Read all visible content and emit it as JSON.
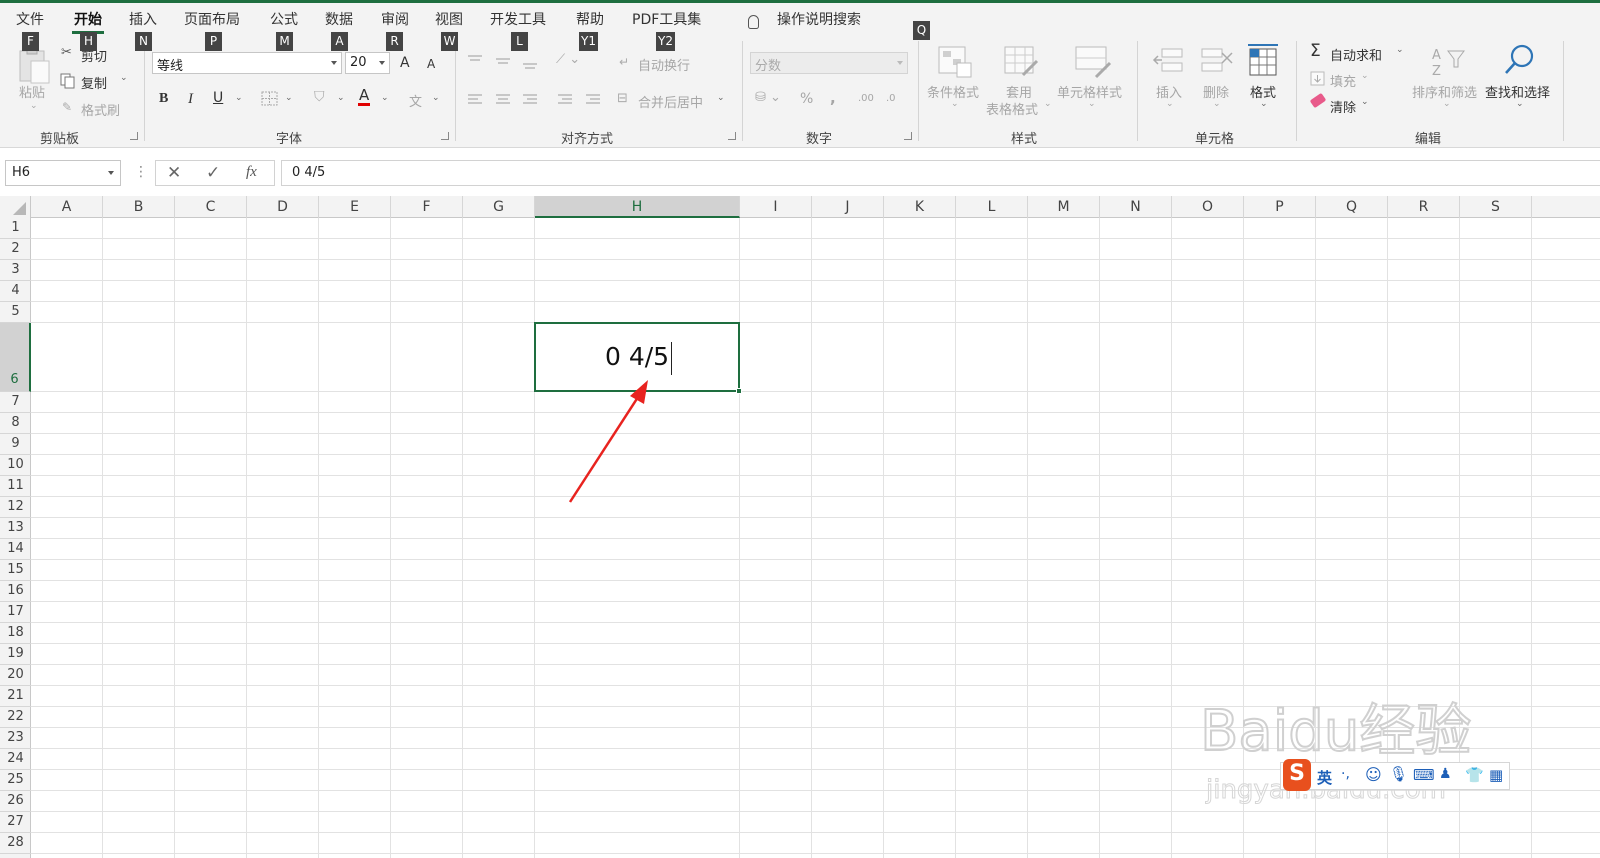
{
  "ribbon_tabs": [
    {
      "label": "文件",
      "key": "F",
      "active": false
    },
    {
      "label": "开始",
      "key": "H",
      "active": true
    },
    {
      "label": "插入",
      "key": "N",
      "active": false
    },
    {
      "label": "页面布局",
      "key": "P",
      "active": false
    },
    {
      "label": "公式",
      "key": "M",
      "active": false
    },
    {
      "label": "数据",
      "key": "A",
      "active": false
    },
    {
      "label": "审阅",
      "key": "R",
      "active": false
    },
    {
      "label": "视图",
      "key": "W",
      "active": false
    },
    {
      "label": "开发工具",
      "key": "L",
      "active": false
    },
    {
      "label": "帮助",
      "key": "Y1",
      "active": false
    },
    {
      "label": "PDF工具集",
      "key": "Y2",
      "active": false
    }
  ],
  "tell_me": {
    "label": "操作说明搜索",
    "key": "Q"
  },
  "clipboard": {
    "paste": "粘贴",
    "cut": "剪切",
    "copy": "复制",
    "format_painter": "格式刷",
    "group": "剪贴板"
  },
  "font": {
    "name": "等线",
    "size": "20",
    "grow": "A",
    "shrink": "A",
    "bold": "B",
    "italic": "I",
    "underline": "U",
    "font_color": "A",
    "phonetic": "文",
    "group": "字体"
  },
  "alignment": {
    "wrap_text": "自动换行",
    "merge_center": "合并后居中",
    "group": "对齐方式"
  },
  "number": {
    "format": "分数",
    "percent": "%",
    "comma": ",",
    "inc_decimal": ".00",
    "dec_decimal": ".0",
    "group": "数字"
  },
  "styles": {
    "conditional": "条件格式",
    "format_table_1": "套用",
    "format_table_2": "表格格式",
    "cell_styles": "单元格样式",
    "group": "样式"
  },
  "cells_group": {
    "insert": "插入",
    "delete": "删除",
    "format": "格式",
    "group": "单元格"
  },
  "editing": {
    "autosum": "自动求和",
    "fill": "填充",
    "clear": "清除",
    "sort_filter": "排序和筛选",
    "find_select": "查找和选择",
    "group": "编辑"
  },
  "formula_bar": {
    "name_box": "H6",
    "content": "0 4/5"
  },
  "columns": [
    "A",
    "B",
    "C",
    "D",
    "E",
    "F",
    "G",
    "H",
    "I",
    "J",
    "K",
    "L",
    "M",
    "N",
    "O",
    "P",
    "Q",
    "R",
    "S"
  ],
  "rows": [
    "1",
    "2",
    "3",
    "4",
    "5",
    "6",
    "7",
    "8",
    "9",
    "10",
    "11",
    "12",
    "13",
    "14",
    "15",
    "16",
    "17",
    "18",
    "19",
    "20",
    "21",
    "22",
    "23",
    "24",
    "25",
    "26",
    "27",
    "28"
  ],
  "active_cell": {
    "ref": "H6",
    "value": "0 4/5"
  },
  "watermark": {
    "text": "Baidu经验",
    "url": "jingyan.baidu.com"
  },
  "ime": {
    "lang": "英"
  },
  "colors": {
    "accent": "#1e6e3f",
    "arrow": "#e8231f",
    "ribbon_bg": "#f3f3f3"
  }
}
